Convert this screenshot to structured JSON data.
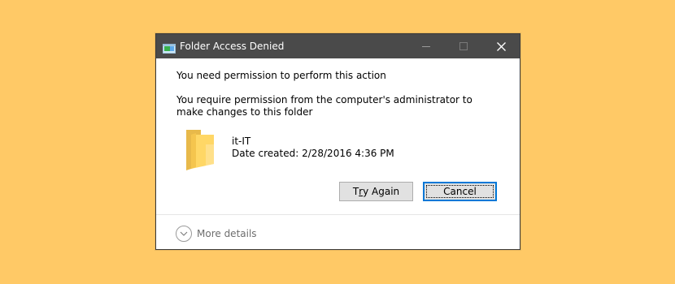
{
  "window": {
    "title": "Folder Access Denied",
    "icon": "folder-access-icon",
    "controls": {
      "minimize": "minimize-icon",
      "maximize": "maximize-icon",
      "close": "close-icon"
    }
  },
  "messages": {
    "primary": "You need permission to perform this action",
    "secondary": "You require permission from the computer's administrator to make changes to this folder"
  },
  "item": {
    "icon": "folder-icon",
    "name": "it-IT",
    "date_created": "Date created: 2/28/2016 4:36 PM"
  },
  "buttons": {
    "try_again": {
      "prefix": "T",
      "underline": "r",
      "suffix": "y Again"
    },
    "cancel": "Cancel"
  },
  "footer": {
    "more_details": "More details",
    "icon": "chevron-down-icon"
  },
  "colors": {
    "background": "#FFC966",
    "titlebar": "#4A4A4A",
    "focus_border": "#0078D7",
    "button_face": "#E1E1E1"
  }
}
